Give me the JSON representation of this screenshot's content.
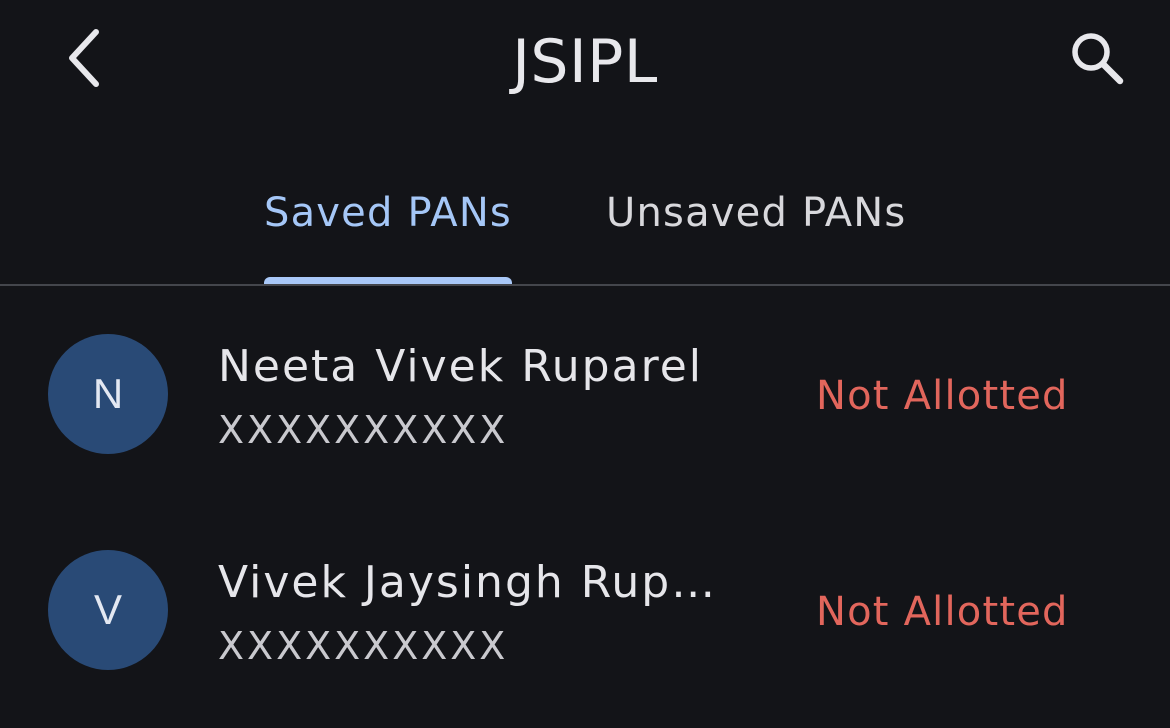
{
  "header": {
    "title": "JSIPL",
    "back_icon": "chevron-left-icon",
    "search_icon": "search-icon"
  },
  "tabs": [
    {
      "label": "Saved PANs",
      "active": true
    },
    {
      "label": "Unsaved PANs",
      "active": false
    }
  ],
  "list": {
    "items": [
      {
        "initial": "N",
        "name": "Neeta Vivek Ruparel",
        "pan": "XXXXXXXXXX",
        "status": "Not Allotted"
      },
      {
        "initial": "V",
        "name": "Vivek Jaysingh Rup…",
        "pan": "XXXXXXXXXX",
        "status": "Not Allotted"
      }
    ]
  },
  "colors": {
    "background": "#131418",
    "accent": "#a5c7f7",
    "avatar": "#294a76",
    "status_error": "#e2665c",
    "divider": "#44464c"
  }
}
